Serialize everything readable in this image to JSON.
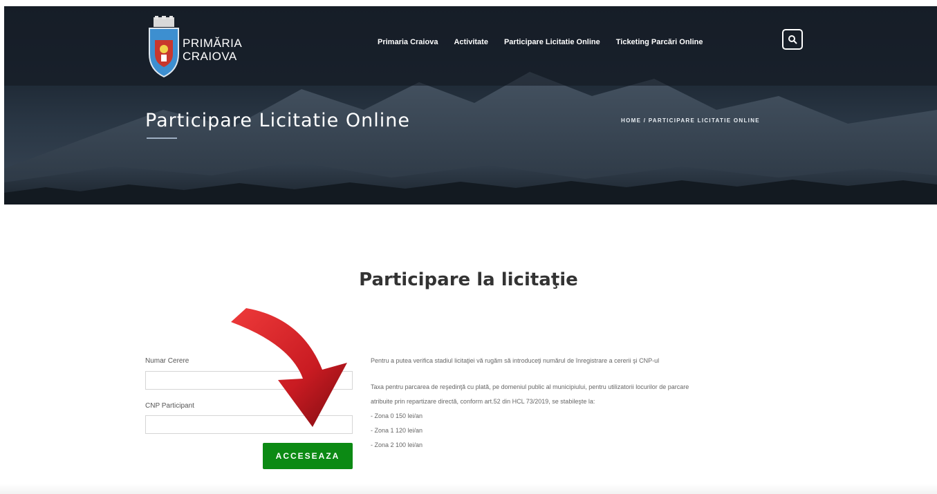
{
  "header": {
    "logo_line1": "PRIMĂRIA",
    "logo_line2": "CRAIOVA",
    "nav": [
      "Primaria Craiova",
      "Activitate",
      "Participare Licitatie Online",
      "Ticketing Parcări Online"
    ],
    "search_icon": "search-icon"
  },
  "hero": {
    "title": "Participare Licitatie Online",
    "breadcrumb": "HOME / PARTICIPARE LICITATIE ONLINE"
  },
  "main": {
    "title": "Participare la licitaţie",
    "form": {
      "numar_cerere_label": "Numar Cerere",
      "numar_cerere_value": "",
      "cnp_label": "CNP Participant",
      "cnp_value": "",
      "submit_label": "ACCESEAZA"
    },
    "info": {
      "line1": "Pentru a putea verifica stadiul licitaţiei vă rugăm să introduceţi numărul de înregistrare a cererii şi CNP-ul",
      "line2": "Taxa pentru parcarea de reşedinţă cu plată, pe domeniul public al municipiului, pentru utilizatorii locurilor de parcare",
      "line3": "atribuite prin repartizare directă, conform art.52 din HCL 73/2019, se stabileşte la:",
      "zones": [
        "- Zona 0 150 lei/an",
        "- Zona 1 120 lei/an",
        "- Zona 2 100 lei/an"
      ]
    }
  },
  "colors": {
    "hero_dark": "#1c2530",
    "button_green": "#0c8a14",
    "arrow_red": "#d71f26"
  }
}
